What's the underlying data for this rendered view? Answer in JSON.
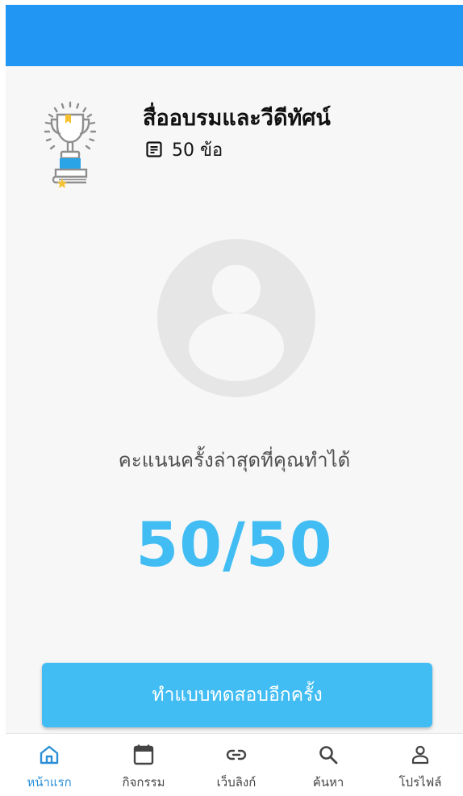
{
  "quiz": {
    "title": "สื่ออบรมและวีดีทัศน์",
    "question_count": "50 ข้อ",
    "icon": "trophy-on-books-icon"
  },
  "result": {
    "label": "คะแนนครั้งล่าสุดที่คุณทำได้",
    "score": "50/50"
  },
  "actions": {
    "retry_label": "ทำแบบทดสอบอีกครั้ง"
  },
  "bottom_nav": {
    "items": [
      {
        "label": "หน้าแรก",
        "icon": "home-icon",
        "active": true
      },
      {
        "label": "กิจกรรม",
        "icon": "calendar-icon",
        "active": false
      },
      {
        "label": "เว็บลิงก์",
        "icon": "link-icon",
        "active": false
      },
      {
        "label": "ค้นหา",
        "icon": "search-icon",
        "active": false
      },
      {
        "label": "โปรไฟล์",
        "icon": "person-icon",
        "active": false
      }
    ]
  },
  "colors": {
    "app_bar": "#2196f3",
    "accent": "#42bdf3",
    "nav_active": "#2a8fd6"
  }
}
